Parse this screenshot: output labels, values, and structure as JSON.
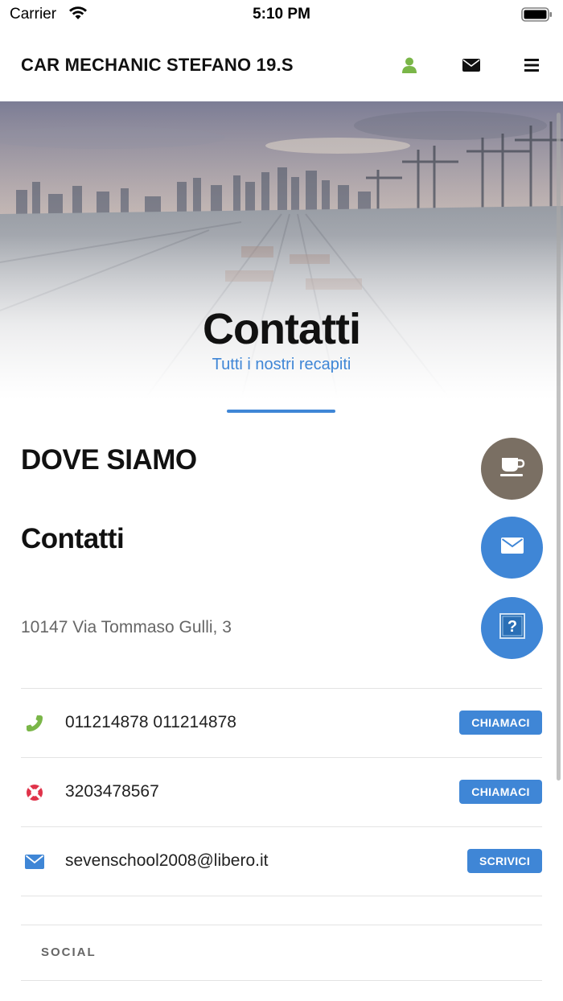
{
  "status_bar": {
    "carrier": "Carrier",
    "time": "5:10 PM"
  },
  "header": {
    "title": "CAR MECHANIC STEFANO 19.S",
    "icons": [
      "user-icon",
      "mail-icon",
      "menu-icon"
    ],
    "accent_color": "#7ab648"
  },
  "hero": {
    "title": "Contatti",
    "subtitle": "Tutti i nostri recapiti"
  },
  "section": {
    "heading": "DOVE SIAMO",
    "subheading": "Contatti",
    "address": "10147 Via Tommaso Gulli, 3"
  },
  "floating_buttons": [
    "coffee-icon",
    "mail-icon",
    "help-icon"
  ],
  "contacts": [
    {
      "icon": "phone-icon",
      "text": "011214878 011214878",
      "action": "CHIAMACI"
    },
    {
      "icon": "lifebuoy-icon",
      "text": "3203478567",
      "action": "CHIAMACI"
    },
    {
      "icon": "mail-icon",
      "text": "sevenschool2008@libero.it",
      "action": "SCRIVICI"
    }
  ],
  "social": {
    "label": "SOCIAL"
  },
  "colors": {
    "primary": "#3f86d6",
    "coffee": "#7a6f63",
    "phone_green": "#7ab648",
    "lifebuoy_red": "#e0334a"
  }
}
